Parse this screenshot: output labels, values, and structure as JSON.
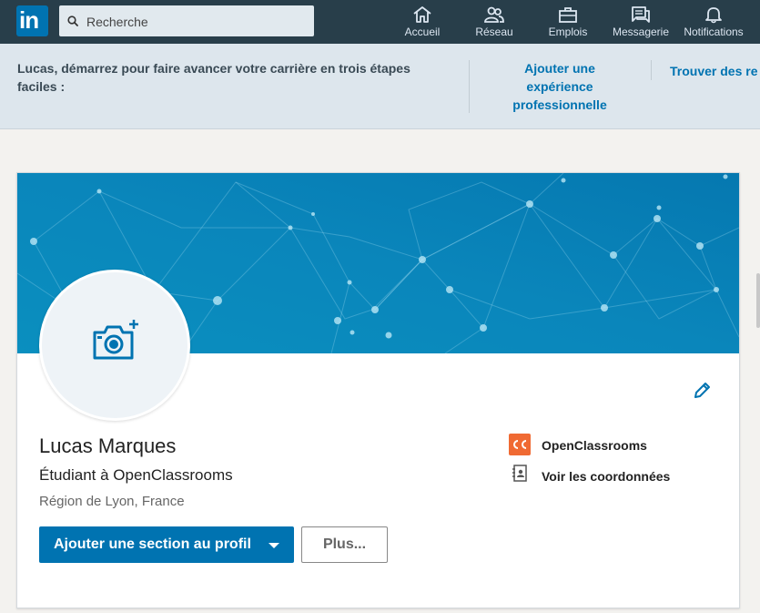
{
  "nav": {
    "search_placeholder": "Recherche",
    "items": [
      {
        "label": "Accueil",
        "icon": "home-icon"
      },
      {
        "label": "Réseau",
        "icon": "network-icon"
      },
      {
        "label": "Emplois",
        "icon": "briefcase-icon"
      },
      {
        "label": "Messagerie",
        "icon": "messaging-icon"
      },
      {
        "label": "Notifications",
        "icon": "bell-icon"
      }
    ]
  },
  "onboarding": {
    "intro": "Lucas, démarrez pour faire avancer votre carrière en trois étapes faciles :",
    "step1": "Ajouter une expérience professionnelle",
    "step2": "Trouver des re"
  },
  "profile": {
    "name": "Lucas Marques",
    "headline": "Étudiant à OpenClassrooms",
    "location": "Région de Lyon, France",
    "company": "OpenClassrooms",
    "contact_link": "Voir les coordonnées",
    "add_section_button": "Ajouter une section au profil",
    "more_button": "Plus..."
  },
  "colors": {
    "nav_bg": "#283e4a",
    "brand_blue": "#0073b1",
    "onboarding_bg": "#dde6ed",
    "oc_orange": "#f06a33"
  }
}
